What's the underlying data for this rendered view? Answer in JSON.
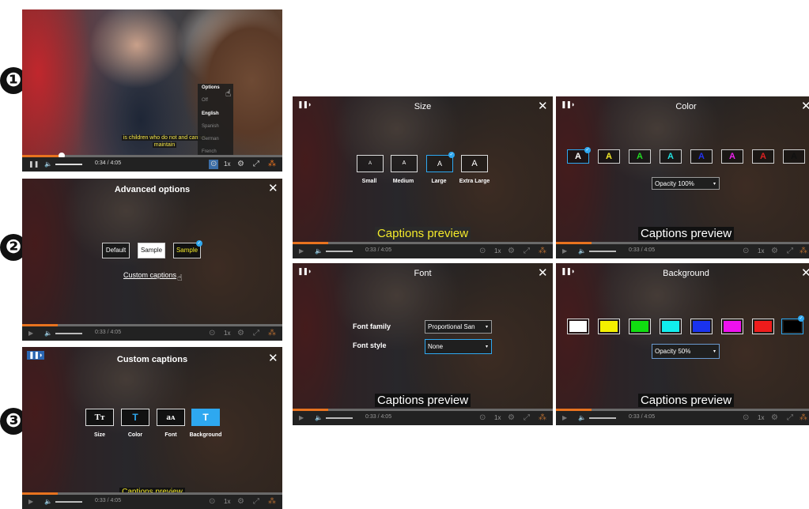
{
  "steps": {
    "one": "❶",
    "two": "❷",
    "three": "❸"
  },
  "player": {
    "time": "0:34",
    "time_sep": "/ 4:05",
    "time_dim": "0:33",
    "speed": "1x"
  },
  "panel1": {
    "subtitle_line1": "is children who do not and cannot",
    "subtitle_line2": "maintain",
    "menu_items": [
      "Options",
      "Off",
      "English",
      "Spanish",
      "German",
      "French"
    ],
    "subtitle_color": "#f4e64a"
  },
  "panel2": {
    "title": "Advanced options",
    "close": "✕",
    "preset_default": "Default",
    "preset_sample_white": "Sample",
    "preset_sample_yellow": "Sample",
    "custom_link": "Custom captions"
  },
  "panel3": {
    "title": "Custom captions",
    "close": "✕",
    "buttons": [
      {
        "glyph": "Tт",
        "label": "Size"
      },
      {
        "glyph": "T",
        "label": "Color"
      },
      {
        "glyph": "aᴀ",
        "label": "Font"
      },
      {
        "glyph": "T",
        "label": "Background"
      }
    ],
    "preview": "Captions preview"
  },
  "size_panel": {
    "title": "Size",
    "close": "✕",
    "glyph": "A",
    "options": [
      "Small",
      "Medium",
      "Large",
      "Extra Large"
    ],
    "selected": "Large",
    "preview": "Captions preview"
  },
  "color_panel": {
    "title": "Color",
    "close": "✕",
    "glyph": "A",
    "colors": [
      "#ffffff",
      "#f4ea2a",
      "#22dd22",
      "#22e0e0",
      "#2233ee",
      "#ee22ee",
      "#dd2222",
      "#111111"
    ],
    "opacity": "Opacity 100%",
    "preview": "Captions preview"
  },
  "font_panel": {
    "title": "Font",
    "close": "✕",
    "family_label": "Font family",
    "family_value": "Proportional San",
    "style_label": "Font style",
    "style_value": "None",
    "preview": "Captions preview"
  },
  "bg_panel": {
    "title": "Background",
    "close": "✕",
    "colors": [
      "#ffffff",
      "#f4f000",
      "#11dd11",
      "#11eeee",
      "#1a33ee",
      "#ee11ee",
      "#ee1c1c",
      "#000000"
    ],
    "opacity": "Opacity 50%",
    "preview": "Captions preview"
  },
  "icons": {
    "play": "▶",
    "pause": "❚❚",
    "volume": "🔈",
    "cc": "⊙",
    "gear": "⚙",
    "fullscreen": "⤢",
    "cursor": "☝",
    "check": "✓",
    "caret": "▾",
    "logo": "❚❚◗"
  }
}
